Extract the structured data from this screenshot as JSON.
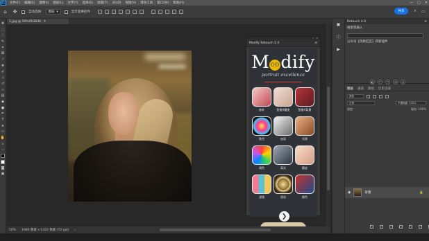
{
  "menu": {
    "logo": "Ps",
    "items": [
      "文件(F)",
      "编辑(E)",
      "图像(I)",
      "图层(L)",
      "文字(Y)",
      "选择(S)",
      "滤镜(T)",
      "3D(D)",
      "视图(V)",
      "增效工具",
      "窗口(W)",
      "帮助(H)"
    ],
    "window_controls": [
      "—",
      "□",
      "✕"
    ]
  },
  "options": {
    "auto_select_label": "自动选择:",
    "layer_select_value": "图层",
    "show_transform_label": "显示变换控件",
    "share_label": "共享"
  },
  "doc_tab": {
    "title": "1.jpg @ 50%(RGB/8)",
    "close": "✕"
  },
  "status": {
    "zoom": "50%",
    "dimensions": "1080 像素 x 1322 像素 (72 ppi)"
  },
  "plugin": {
    "header_title": "Modify Retouch 1.0",
    "brand": {
      "pre": "M",
      "circle": "OD",
      "post": "dify"
    },
    "tagline": "portrait excellence",
    "next_icon": "❯",
    "items": [
      {
        "label": "修补",
        "icon": "lips-icon",
        "bg": "linear-gradient(135deg,#f4c9c4,#c04a56)"
      },
      {
        "label": "智能A醒皮",
        "icon": "face-icon",
        "bg": "linear-gradient(135deg,#f1dcd3,#c9a48f)"
      },
      {
        "label": "智能A背景",
        "icon": "portrait-icon",
        "bg": "linear-gradient(135deg,#b8323b,#5d1d22)"
      },
      {
        "label": "肤色",
        "icon": "color-wheel-icon",
        "bg": "radial-gradient(circle,#ffe34d 0%,#ff3a8c 35%,#3ac9ff 65%,#101010 70%)"
      },
      {
        "label": "加深",
        "icon": "aperture-icon",
        "bg": "linear-gradient(135deg,#f2f2f2,#6a6a6a)"
      },
      {
        "label": "光源",
        "icon": "hair-icon",
        "bg": "linear-gradient(135deg,#e7b07e,#8b4a2a)"
      },
      {
        "label": "调色",
        "icon": "palette-icon",
        "bg": "conic-gradient(#ff4040,#ffd400,#30d158,#0a84ff,#bf5af2,#ff4040)"
      },
      {
        "label": "高光",
        "icon": "model-icon",
        "bg": "linear-gradient(135deg,#9aa4b0,#2d3440)"
      },
      {
        "label": "磨皮",
        "icon": "skin-icon",
        "bg": "linear-gradient(135deg,#f5ddcd,#d79c80)"
      },
      {
        "label": "滤镜",
        "icon": "swatch-icon",
        "bg": "linear-gradient(90deg,#ef7a93 0 33%,#5bc2d6 33% 66%,#f3c65a 66%)"
      },
      {
        "label": "锐化",
        "icon": "target-icon",
        "bg": "radial-gradient(circle,#f0d9a0 0%,#8a6a2a 45%,#f0d9a0 50%,#3a2a10 70%)"
      },
      {
        "label": "颜色",
        "icon": "fashion-icon",
        "bg": "linear-gradient(135deg,#c8322c,#1f4a8a)"
      }
    ]
  },
  "right_strip": {
    "icons": [
      "history-icon",
      "info-icon",
      "play-icon"
    ]
  },
  "right_panel": {
    "retouch_title": "Retouch 4.0",
    "search_placeholder": "搜索或输入",
    "line1": "公众号【风格区区】获取插件",
    "mini_ctrls": [
      "◐",
      "↶",
      "↷",
      "⟲",
      "⊙"
    ],
    "tabs": [
      "图层",
      "通道",
      "路径",
      "历史记录"
    ],
    "kind": "类型",
    "blend": "正常",
    "opacity": "不透明度: 100%",
    "lock_label": "锁定:",
    "fill": "填充: 100%",
    "layer_name": "背景",
    "eye_icon": "◉",
    "lock_icon": "🔒"
  }
}
